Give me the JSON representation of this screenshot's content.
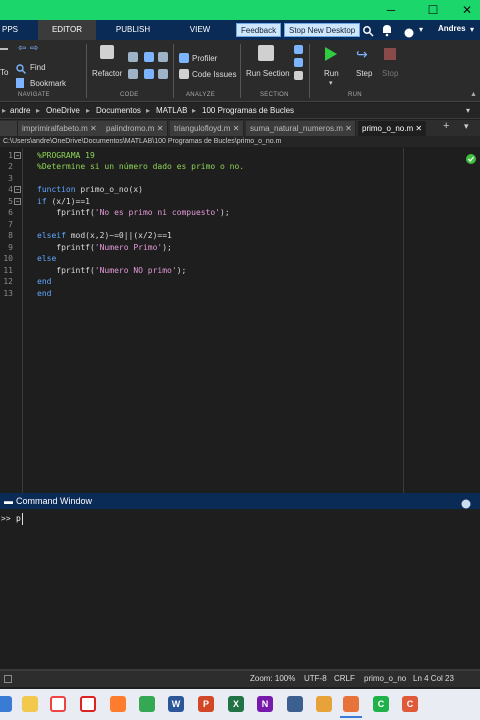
{
  "titlebar": {
    "minimize": "─",
    "restore": "☐",
    "close": "✕"
  },
  "tabs": [
    {
      "label": "PPS"
    },
    {
      "label": "EDITOR"
    },
    {
      "label": "PUBLISH"
    },
    {
      "label": "VIEW"
    }
  ],
  "header": {
    "feedback": "Feedback",
    "stop_desktop": "Stop New Desktop",
    "user": "Andres"
  },
  "ribbon": {
    "nav_partial_label": "To",
    "find_label": "Find",
    "bookmark_label": "Bookmark",
    "refactor_label": "Refactor",
    "profiler_label": "Profiler",
    "code_issues_label": "Code Issues",
    "run_section_label": "Run Section",
    "run_label": "Run",
    "step_label": "Step",
    "stop_label": "Stop",
    "groups": {
      "navigate": "NAVIGATE",
      "code": "CODE",
      "analyze": "ANALYZE",
      "section": "SECTION",
      "run": "RUN"
    }
  },
  "breadcrumb": [
    "andre",
    "OneDrive",
    "Documentos",
    "MATLAB",
    "100 Programas de Bucles"
  ],
  "file_tabs": [
    {
      "label": "imprimiralfabeto.m"
    },
    {
      "label": "palindromo.m"
    },
    {
      "label": "triangulofloyd.m"
    },
    {
      "label": "suma_natural_numeros.m"
    },
    {
      "label": "primo_o_no.m"
    }
  ],
  "file_path": "C:\\Users\\andre\\OneDrive\\Documentos\\MATLAB\\100 Programas de Bucles\\primo_o_no.m",
  "editor": {
    "line_numbers": [
      "1",
      "2",
      "3",
      "4",
      "5",
      "6",
      "7",
      "8",
      "9",
      "10",
      "11",
      "12",
      "13"
    ],
    "lines": {
      "l1": "%PROGRAMA 19",
      "l2": "%Determine si un número dado es primo o no.",
      "l4_kw": "function",
      "l4_rest": " primo_o_no(x)",
      "l5_kw": "if",
      "l5_rest": " (x/1)==1",
      "l6_pre": "    fprintf(",
      "l6_str": "'No es primo ni compuesto'",
      "l6_post": ");",
      "l8_kw": "elseif",
      "l8_rest": " mod(x,2)~=0||(x/2)==1",
      "l9_pre": "    fprintf(",
      "l9_str": "'Numero Primo'",
      "l9_post": ");",
      "l10_kw": "else",
      "l11_pre": "    fprintf(",
      "l11_str": "'Numero NO primo'",
      "l11_post": ");",
      "l12_kw": "end",
      "l13_kw": "end"
    }
  },
  "command_window": {
    "title": "Command Window",
    "prompt": ">>",
    "input": "p"
  },
  "status": {
    "zoom": "Zoom: 100%",
    "encoding": "UTF-8",
    "eol": "CRLF",
    "file": "primo_o_no",
    "position": "Ln 4 Col 23"
  },
  "colors": {
    "title_green": "#1bd66b",
    "tab_navy": "#0b2b57",
    "keyword": "#5fa8ff",
    "string": "#e39ad8",
    "comment": "#8ed455"
  }
}
